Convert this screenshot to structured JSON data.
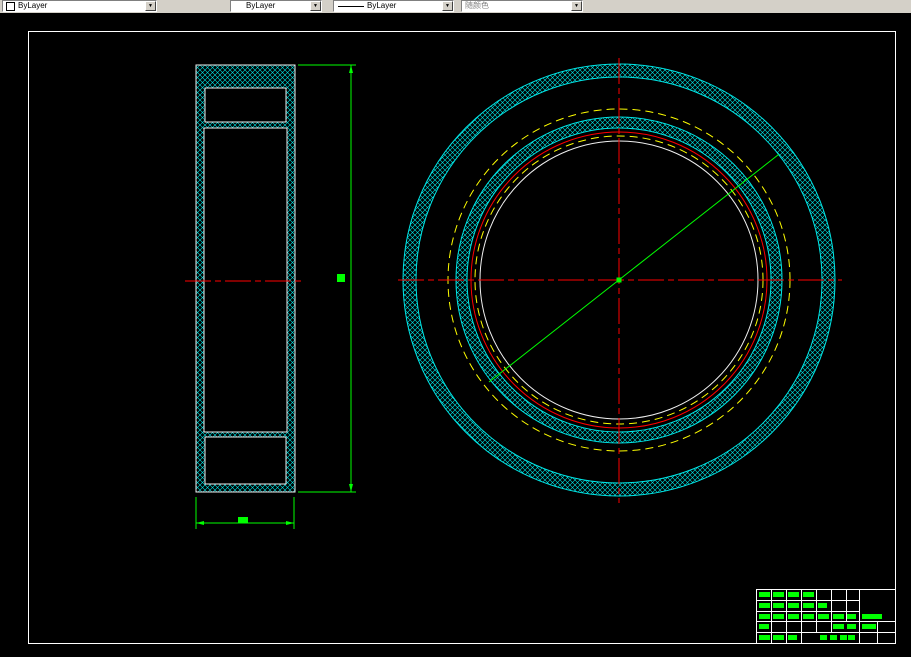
{
  "toolbar": {
    "color_control": {
      "value": "ByLayer"
    },
    "linetype_control": {
      "value": "ByLayer"
    },
    "lineweight_control": {
      "value": "ByLayer"
    },
    "plot_style_control": {
      "value": "随颜色"
    }
  },
  "colors": {
    "canvas_background": "#000000",
    "toolbar_background": "#d4d0c8",
    "frame": "#ffffff",
    "object_line": "#f0f0f0",
    "hatch": "#00e6e6",
    "centerline": "#ff0000",
    "dimension": "#00ff00",
    "hidden_line": "#ffff00"
  }
}
